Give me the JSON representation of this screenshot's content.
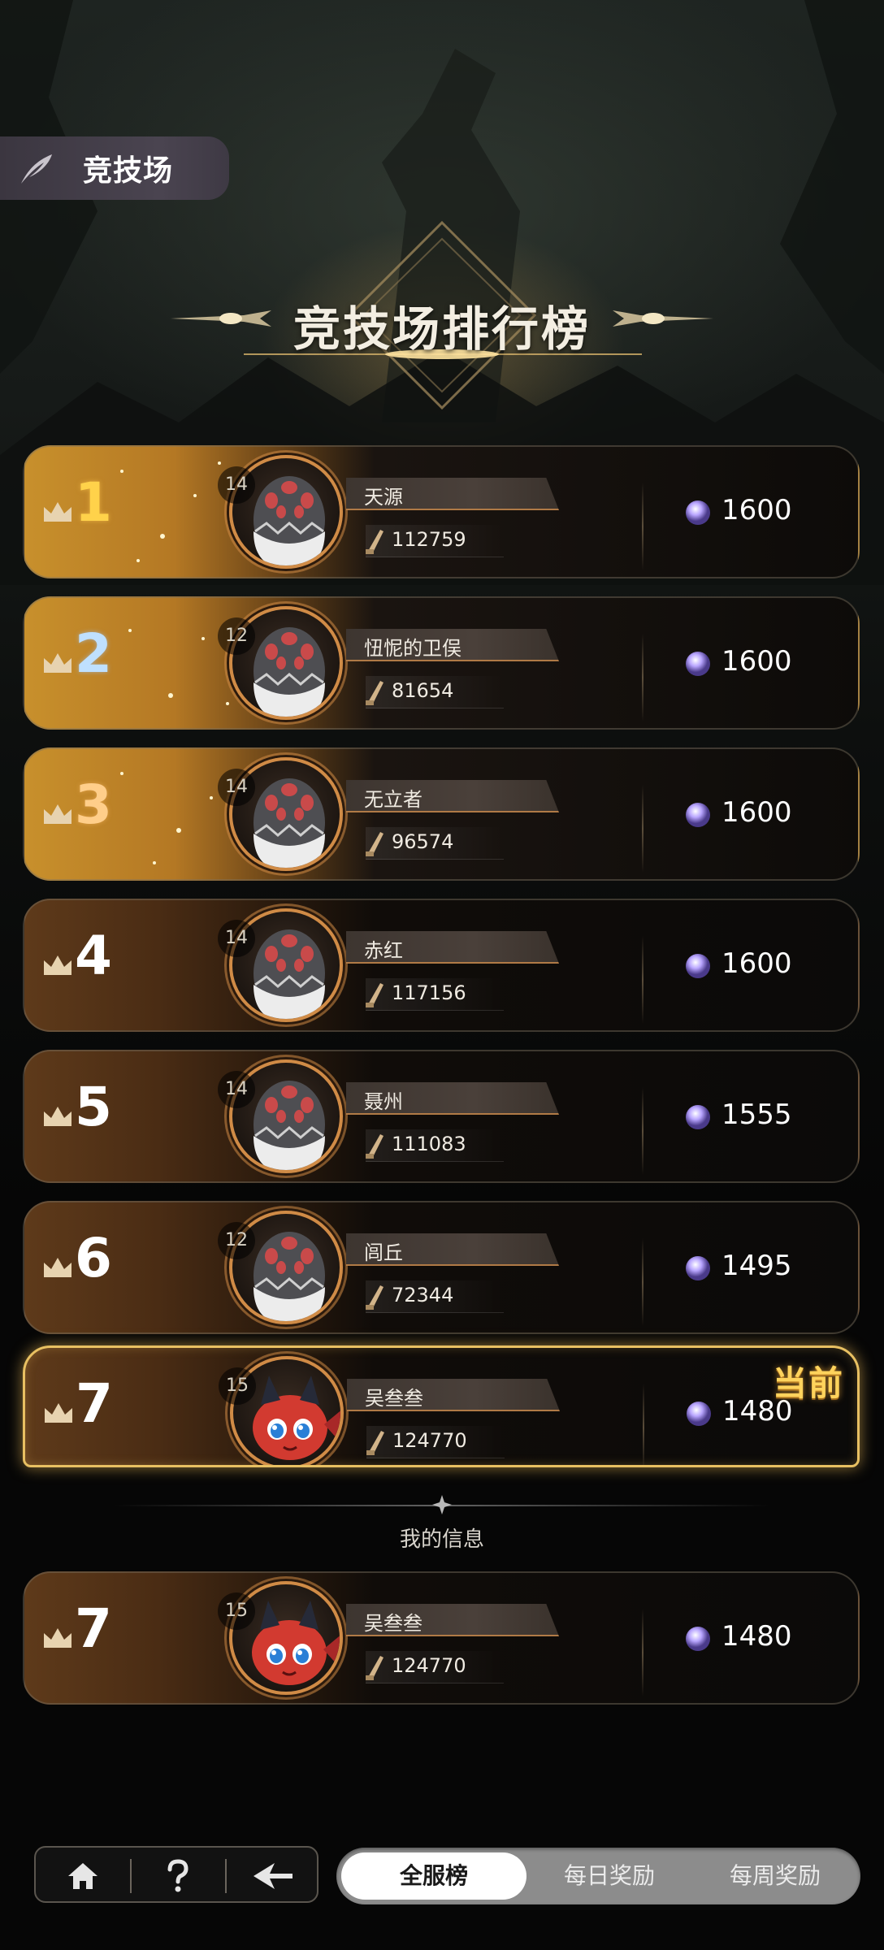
{
  "top_tag": {
    "label": "竞技场"
  },
  "page_title": "竞技场排行榜",
  "rows": [
    {
      "rank": "1",
      "level": "14",
      "name": "天源",
      "power": "112759",
      "score": "1600",
      "avatar": "egg"
    },
    {
      "rank": "2",
      "level": "12",
      "name": "忸怩的卫俣",
      "power": "81654",
      "score": "1600",
      "avatar": "egg"
    },
    {
      "rank": "3",
      "level": "14",
      "name": "无立者",
      "power": "96574",
      "score": "1600",
      "avatar": "egg"
    },
    {
      "rank": "4",
      "level": "14",
      "name": "赤红",
      "power": "117156",
      "score": "1600",
      "avatar": "egg"
    },
    {
      "rank": "5",
      "level": "14",
      "name": "聂州",
      "power": "111083",
      "score": "1555",
      "avatar": "egg"
    },
    {
      "rank": "6",
      "level": "12",
      "name": "闾丘",
      "power": "72344",
      "score": "1495",
      "avatar": "egg"
    },
    {
      "rank": "7",
      "level": "15",
      "name": "吴叁叁",
      "power": "124770",
      "score": "1480",
      "avatar": "red-dragon",
      "current_tag": "当前"
    }
  ],
  "my_info": {
    "label": "我的信息",
    "rank": "7",
    "level": "15",
    "name": "吴叁叁",
    "power": "124770",
    "score": "1480",
    "avatar": "red-dragon"
  },
  "bottom_nav": {
    "icons": [
      "home-icon",
      "help-icon",
      "back-arrow-icon"
    ]
  },
  "tabs": [
    {
      "label": "全服榜",
      "active": true
    },
    {
      "label": "每日奖励",
      "active": false
    },
    {
      "label": "每周奖励",
      "active": false
    }
  ],
  "colors": {
    "gold": "#c8902c",
    "bronze": "#5e3a1a",
    "current_border": "#e8c062",
    "current_tag": "#ffd35c"
  }
}
